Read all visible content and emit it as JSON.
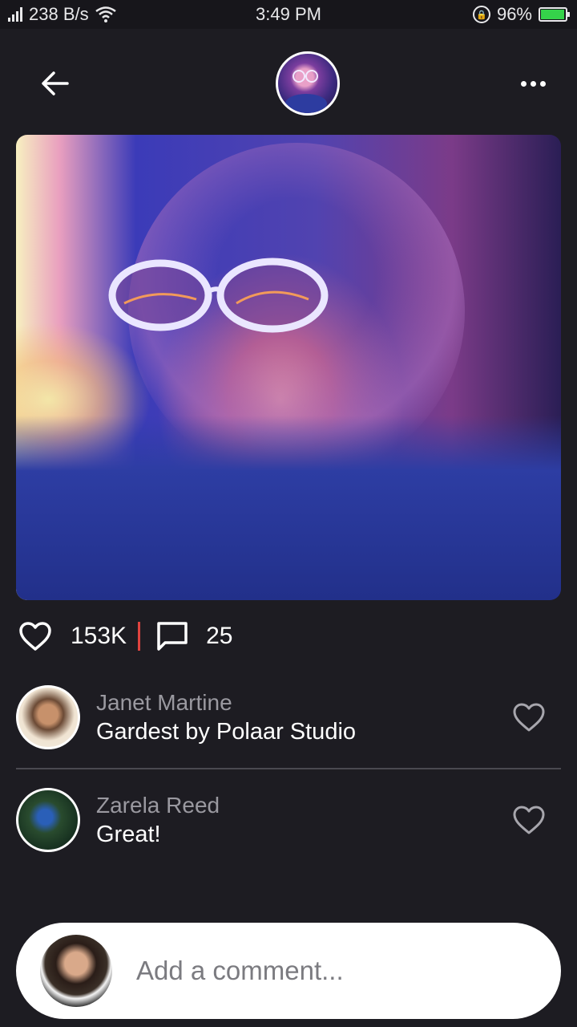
{
  "status_bar": {
    "network_speed": "238 B/s",
    "time": "3:49 PM",
    "battery": "96%",
    "battery_level": 0.96
  },
  "header": {
    "back_icon": "arrow-left-icon",
    "more_icon": "more-horizontal-icon"
  },
  "post": {
    "likes": "153K",
    "comments": "25"
  },
  "comments": [
    {
      "name": "Janet Martine",
      "text": "Gardest by Polaar Studio"
    },
    {
      "name": "Zarela Reed",
      "text": "Great!"
    }
  ],
  "composer": {
    "placeholder": "Add a comment..."
  },
  "colors": {
    "background": "#1d1c22",
    "divider_accent": "#e0433f",
    "battery_green": "#35d24a"
  }
}
